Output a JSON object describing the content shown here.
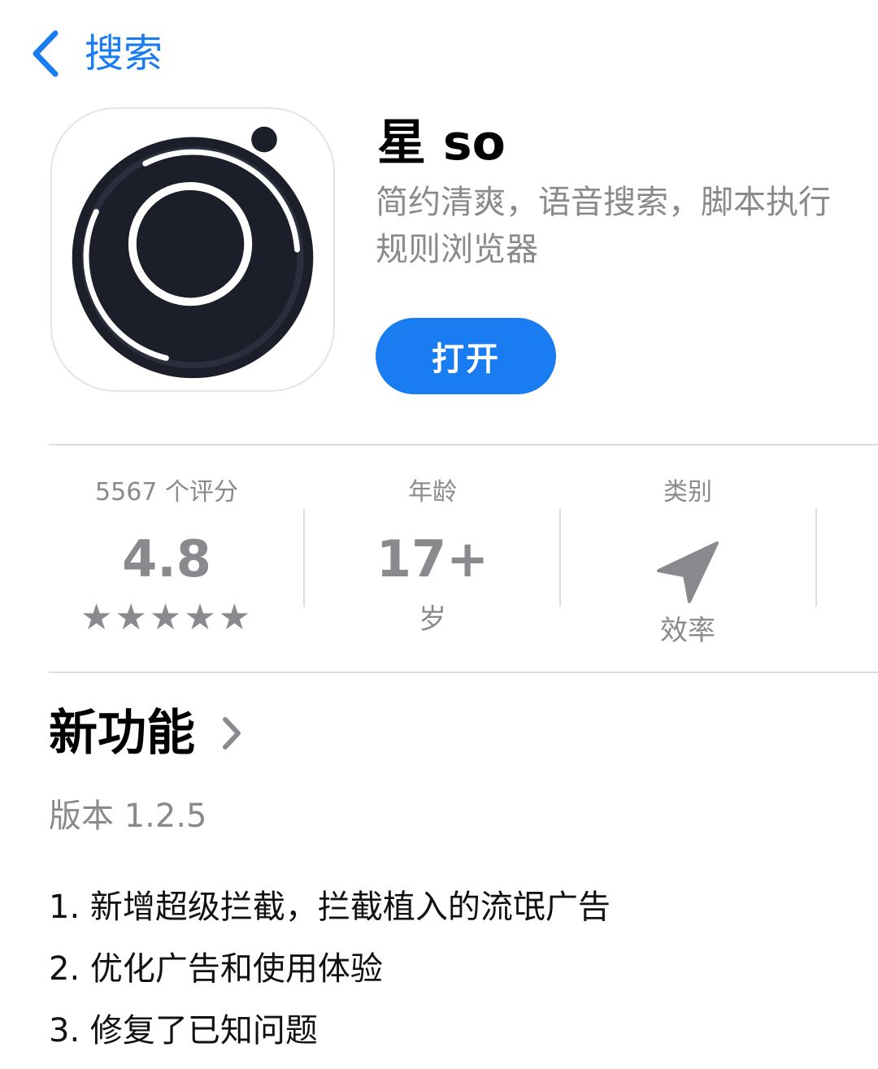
{
  "nav": {
    "back_label": "搜索",
    "accent_color": "#1A7CF1"
  },
  "app": {
    "name": "星 so",
    "subtitle": "简约清爽，语音搜索，脚本执行\n规则浏览器",
    "open_label": "打开",
    "icon": "camera-lens-app-icon"
  },
  "info": {
    "ratings": {
      "label": "5567 个评分",
      "value": "4.8",
      "stars": "★★★★★",
      "star_count": 5
    },
    "age": {
      "label": "年龄",
      "value": "17+",
      "sub": "岁"
    },
    "category": {
      "label": "类别",
      "icon": "paper-plane-icon",
      "value": "效率"
    }
  },
  "whats_new": {
    "title": "新功能",
    "version": "版本 1.2.5",
    "notes": [
      "1. 新增超级拦截，拦截植入的流氓广告",
      "2. 优化广告和使用体验",
      "3. 修复了已知问题"
    ]
  }
}
